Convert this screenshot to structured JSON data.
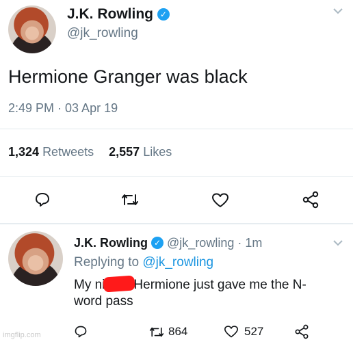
{
  "tweet1": {
    "name": "J.K. Rowling",
    "verified_glyph": "✓",
    "handle": "@jk_rowling",
    "text": "Hermione Granger was black",
    "timestamp": "2:49 PM · 03 Apr 19",
    "retweets_count": "1,324",
    "retweets_label": "Retweets",
    "likes_count": "2,557",
    "likes_label": "Likes",
    "icons": [
      "reply-icon",
      "retweet-icon",
      "like-icon",
      "share-icon"
    ]
  },
  "reply": {
    "name": "J.K. Rowling",
    "verified_glyph": "✓",
    "handle": "@jk_rowling",
    "time": "· 1m",
    "replying_prefix": "Replying to",
    "replying_handle": "@jk_rowling",
    "text_before": "My ni",
    "text_after": "Hermione just gave me the N-",
    "text_line2": "word pass",
    "retweet_count": "864",
    "like_count": "527"
  },
  "watermark": "imgflip.com",
  "colors": {
    "accent": "#1da1f2",
    "link": "#1b95e0",
    "muted": "#657786",
    "redaction": "#ff1a1a"
  }
}
